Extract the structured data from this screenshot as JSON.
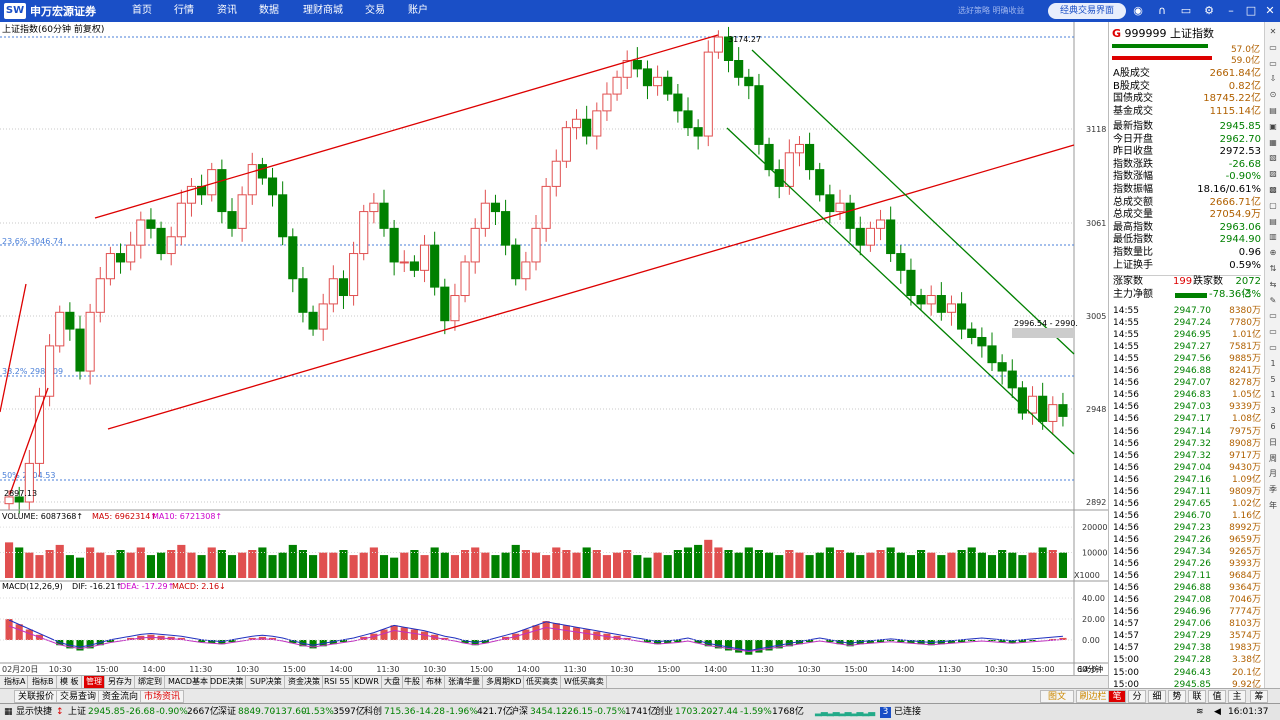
{
  "app": {
    "logo_text": "申万宏源证券",
    "nav": [
      "首页",
      "行情",
      "资讯",
      "数据",
      "理财商城",
      "交易",
      "账户"
    ],
    "slogan": "选好策略 明确收益",
    "classic_button": "经典交易界面",
    "icons": [
      "user-center-icon",
      "headset-icon",
      "message-icon",
      "settings-icon",
      "minimize-icon",
      "maximize-icon",
      "close-icon"
    ]
  },
  "chart_header": {
    "title": "上证指数(60分钟 前复权)",
    "volume_label": "VOLUME: 6087368↑",
    "ma5_label": "MA5: 6962314↑",
    "ma10_label": "MA10: 6721308↑",
    "macd_label": "MACD(12,26,9)",
    "dif_label": "DIF: -16.21↑",
    "dea_label": "DEA: -17.29↑",
    "macd_val_label": "MACD: 2.16↓",
    "period_label": "60分钟",
    "vol_unit": "X1000"
  },
  "chart_data": {
    "type": "candlestick",
    "price_axis_ticks": [
      "3118",
      "3061",
      "3005",
      "2948",
      "2892"
    ],
    "volume_axis_ticks": [
      "20000",
      "10000"
    ],
    "macd_axis_ticks": [
      "40.00",
      "20.00",
      "0.00"
    ],
    "x_labels": [
      "02月20日",
      "10:30",
      "15:00",
      "14:00",
      "11:30",
      "10:30",
      "15:00",
      "14:00",
      "11:30",
      "10:30",
      "15:00",
      "14:00",
      "11:30",
      "10:30",
      "15:00",
      "14:00",
      "11:30",
      "10:30",
      "15:00",
      "14:00",
      "11:30",
      "10:30",
      "15:00",
      "14:0"
    ],
    "annotations": {
      "high": "3174.27",
      "low": "2897.13",
      "fib_236": "23.6% 3046.74",
      "fib_382": "38.2% 2988.09",
      "fib_50": "50% 2904.53",
      "range_box": "2996.54 - 2990."
    },
    "ylim": [
      2870,
      3180
    ],
    "close_series": [
      2900,
      2897,
      2920,
      2960,
      2990,
      3010,
      3000,
      2975,
      3010,
      3030,
      3045,
      3040,
      3050,
      3065,
      3060,
      3045,
      3055,
      3075,
      3085,
      3080,
      3095,
      3070,
      3060,
      3080,
      3098,
      3090,
      3080,
      3055,
      3030,
      3010,
      3000,
      3015,
      3030,
      3020,
      3045,
      3070,
      3075,
      3060,
      3040,
      3040,
      3035,
      3050,
      3025,
      3005,
      3020,
      3040,
      3060,
      3075,
      3070,
      3050,
      3030,
      3040,
      3060,
      3085,
      3100,
      3120,
      3125,
      3115,
      3130,
      3140,
      3150,
      3160,
      3155,
      3145,
      3150,
      3140,
      3130,
      3120,
      3115,
      3165,
      3174,
      3160,
      3150,
      3145,
      3110,
      3095,
      3085,
      3105,
      3110,
      3095,
      3080,
      3070,
      3075,
      3060,
      3050,
      3060,
      3065,
      3045,
      3035,
      3020,
      3015,
      3020,
      3010,
      3015,
      3000,
      2995,
      2990,
      2980,
      2975,
      2965,
      2950,
      2960,
      2945,
      2955,
      2948
    ],
    "volume_series": [
      14000,
      12000,
      10000,
      9000,
      11000,
      13000,
      9000,
      8000,
      12000,
      10000,
      9000,
      11000,
      10000,
      12000,
      9000,
      10000,
      11000,
      13000,
      10000,
      9000,
      12000,
      11000,
      9000,
      10000,
      11000,
      12000,
      9000,
      10000,
      13000,
      11000,
      9000,
      10000,
      10000,
      11000,
      9000,
      10000,
      12000,
      9000,
      8000,
      10000,
      11000,
      9000,
      12000,
      10000,
      9000,
      11000,
      12000,
      10000,
      9000,
      10000,
      13000,
      11000,
      10000,
      9000,
      12000,
      11000,
      10000,
      12000,
      11000,
      9000,
      10000,
      11000,
      9000,
      8000,
      10000,
      9000,
      11000,
      12000,
      13000,
      15000,
      12000,
      11000,
      10000,
      12000,
      11000,
      10000,
      9000,
      11000,
      10000,
      9000,
      10000,
      12000,
      11000,
      10000,
      9000,
      10000,
      11000,
      12000,
      10000,
      9000,
      11000,
      10000,
      9000,
      10000,
      11000,
      12000,
      10000,
      9000,
      11000,
      10000,
      9000,
      10000,
      12000,
      11000,
      10000
    ],
    "macd_series": [
      20,
      15,
      10,
      5,
      0,
      -5,
      -8,
      -10,
      -8,
      -5,
      -2,
      0,
      2,
      4,
      5,
      4,
      3,
      2,
      0,
      -2,
      -3,
      -4,
      -2,
      0,
      2,
      3,
      2,
      0,
      -3,
      -6,
      -8,
      -6,
      -4,
      -2,
      0,
      3,
      6,
      10,
      14,
      12,
      10,
      8,
      5,
      2,
      0,
      -3,
      -5,
      -3,
      0,
      3,
      6,
      10,
      14,
      18,
      16,
      14,
      12,
      10,
      8,
      6,
      4,
      2,
      0,
      -2,
      -4,
      -3,
      -2,
      0,
      -3,
      -6,
      -8,
      -10,
      -12,
      -14,
      -12,
      -10,
      -8,
      -6,
      -4,
      -2,
      0,
      -2,
      -4,
      -6,
      -4,
      -3,
      -2,
      -1,
      -2,
      -3,
      -4,
      -5,
      -4,
      -3,
      -2,
      -1,
      0,
      -1,
      -2,
      -3,
      -2,
      -1,
      0,
      1,
      2
    ]
  },
  "quote": {
    "code_line": "999999 上证指数",
    "bar_up": "57.0亿",
    "bar_down": "59.0亿",
    "rows1": [
      {
        "k": "A股成交",
        "v": "2661.84亿"
      },
      {
        "k": "B股成交",
        "v": "0.82亿"
      },
      {
        "k": "国债成交",
        "v": "18745.22亿"
      },
      {
        "k": "基金成交",
        "v": "1115.14亿"
      }
    ],
    "rows2": [
      {
        "k": "最新指数",
        "v": "2945.85",
        "c": "green"
      },
      {
        "k": "今日开盘",
        "v": "2962.70",
        "c": "green"
      },
      {
        "k": "昨日收盘",
        "v": "2972.53",
        "c": ""
      },
      {
        "k": "指数涨跌",
        "v": "-26.68",
        "c": "green"
      },
      {
        "k": "指数涨幅",
        "v": "-0.90%",
        "c": "green"
      },
      {
        "k": "指数振幅",
        "v": "18.16/0.61%",
        "c": ""
      },
      {
        "k": "总成交额",
        "v": "2666.71亿",
        "c": "orange"
      },
      {
        "k": "总成交量",
        "v": "27054.9万",
        "c": "orange"
      },
      {
        "k": "最高指数",
        "v": "2963.06",
        "c": "green"
      },
      {
        "k": "最低指数",
        "v": "2944.90",
        "c": "green"
      },
      {
        "k": "指数量比",
        "v": "0.96",
        "c": ""
      },
      {
        "k": "上证换手",
        "v": "0.59%",
        "c": ""
      }
    ],
    "up_label": "涨家数",
    "up_count": "199",
    "down_label": "跌家数",
    "down_count": "2072",
    "net_label": "主力净额",
    "net_value": "-78.36亿",
    "net_pct": "-3%",
    "ticks": [
      [
        "14:55",
        "2947.70",
        "8380万",
        "green"
      ],
      [
        "14:55",
        "2947.24",
        "7780万",
        "green"
      ],
      [
        "14:55",
        "2946.95",
        "1.01亿",
        "green"
      ],
      [
        "14:55",
        "2947.27",
        "7581万",
        "green"
      ],
      [
        "14:55",
        "2947.56",
        "9885万",
        "green"
      ],
      [
        "14:56",
        "2946.88",
        "8241万",
        "green"
      ],
      [
        "14:56",
        "2947.07",
        "8278万",
        "green"
      ],
      [
        "14:56",
        "2946.83",
        "1.05亿",
        "green"
      ],
      [
        "14:56",
        "2947.03",
        "9339万",
        "green"
      ],
      [
        "14:56",
        "2947.17",
        "1.08亿",
        "green"
      ],
      [
        "14:56",
        "2947.14",
        "7975万",
        "green"
      ],
      [
        "14:56",
        "2947.32",
        "8908万",
        "green"
      ],
      [
        "14:56",
        "2947.32",
        "9717万",
        "green"
      ],
      [
        "14:56",
        "2947.04",
        "9430万",
        "green"
      ],
      [
        "14:56",
        "2947.16",
        "1.09亿",
        "green"
      ],
      [
        "14:56",
        "2947.11",
        "9809万",
        "green"
      ],
      [
        "14:56",
        "2947.65",
        "1.02亿",
        "green"
      ],
      [
        "14:56",
        "2946.70",
        "1.16亿",
        "green"
      ],
      [
        "14:56",
        "2947.23",
        "8992万",
        "green"
      ],
      [
        "14:56",
        "2947.26",
        "9659万",
        "green"
      ],
      [
        "14:56",
        "2947.34",
        "9265万",
        "green"
      ],
      [
        "14:56",
        "2947.26",
        "9393万",
        "green"
      ],
      [
        "14:56",
        "2947.11",
        "9684万",
        "green"
      ],
      [
        "14:56",
        "2946.88",
        "9364万",
        "green"
      ],
      [
        "14:56",
        "2947.08",
        "7046万",
        "green"
      ],
      [
        "14:56",
        "2946.96",
        "7774万",
        "green"
      ],
      [
        "14:57",
        "2947.06",
        "8103万",
        "green"
      ],
      [
        "14:57",
        "2947.29",
        "3574万",
        "green"
      ],
      [
        "14:57",
        "2947.38",
        "1983万",
        "green"
      ],
      [
        "15:00",
        "2947.28",
        "3.38亿",
        "green"
      ],
      [
        "15:00",
        "2946.43",
        "20.1亿",
        "green"
      ],
      [
        "15:00",
        "2945.85",
        "9.92亿",
        "green"
      ]
    ]
  },
  "bottom_tabs": [
    "指标A",
    "指标B",
    "模 板",
    "管理",
    "另存为",
    "绑定到",
    "MACD基本",
    "DDE决策",
    "SUP决策",
    "资金决策",
    "RSI 55",
    "KDWR",
    "大盘",
    "牛股",
    "布林",
    "张清华量",
    "多周期KD",
    "低买高卖",
    "W低买高卖"
  ],
  "low_tabs": [
    "关联报价",
    "交易查询",
    "资金流向",
    "市场资讯"
  ],
  "right_tabs": [
    "图文F10",
    "刷边栏",
    "笔",
    "分",
    "细",
    "势",
    "联",
    "值",
    "主",
    "筹"
  ],
  "status": {
    "quick": "显示快捷",
    "sh": "上证",
    "sh_v": "2945.85",
    "sh_c": "-26.68",
    "sh_p": "-0.90%",
    "sh_a": "2667亿",
    "sz": "深证",
    "sz_v": "8849.70",
    "sz_c": "-137.60",
    "sz_p": "-1.53%",
    "sz_a": "3597亿",
    "kc": "科创",
    "kc_v": "715.36",
    "kc_c": "-14.28",
    "kc_p": "-1.96%",
    "kc_a": "421.7亿",
    "hs": "沪深",
    "hs_v": "3454.12",
    "hs_c": "-26.15",
    "hs_p": "-0.75%",
    "hs_a": "1741亿",
    "cy": "创业",
    "cy_v": "1703.20",
    "cy_c": "-27.44",
    "cy_p": "-1.59%",
    "cy_a": "1768亿",
    "conn": "已连接",
    "conn_n": "3",
    "time": "16:01:37"
  }
}
